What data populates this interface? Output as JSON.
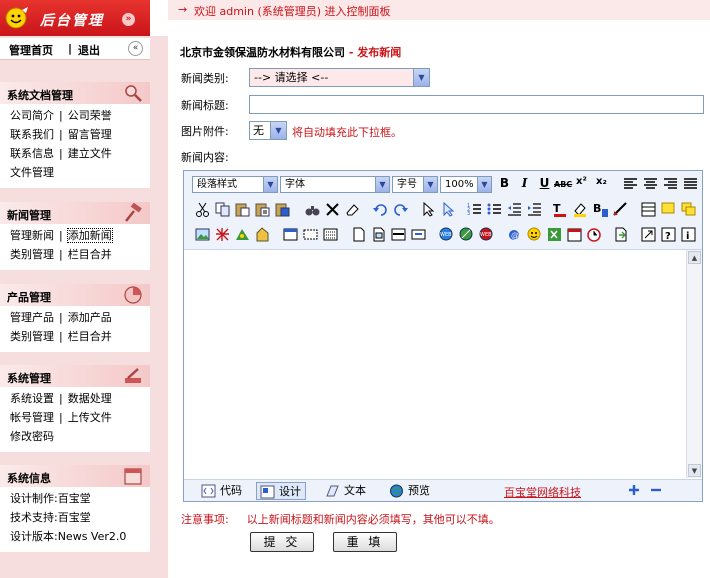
{
  "brand": {
    "title": "后台管理",
    "chevron": "»"
  },
  "nav": {
    "home": "管理首页",
    "separator": "|",
    "exit": "退出",
    "collapse": "«"
  },
  "groups": [
    {
      "title": "系统文档管理",
      "icon": "magnifier-icon",
      "rows": [
        [
          "公司简介",
          "公司荣誉"
        ],
        [
          "联系我们",
          "留言管理"
        ],
        [
          "联系信息",
          "建立文件"
        ],
        [
          "文件管理"
        ]
      ]
    },
    {
      "title": "新闻管理",
      "icon": "hammer-icon",
      "rows": [
        [
          "管理新闻",
          "添加新闻"
        ],
        [
          "类别管理",
          "栏目合并"
        ]
      ]
    },
    {
      "title": "产品管理",
      "icon": "chart-icon",
      "rows": [
        [
          "管理产品",
          "添加产品"
        ],
        [
          "类别管理",
          "栏目合并"
        ]
      ]
    },
    {
      "title": "系统管理",
      "icon": "tools-icon",
      "rows": [
        [
          "系统设置",
          "数据处理"
        ],
        [
          "帐号管理",
          "上传文件"
        ],
        [
          "修改密码"
        ]
      ]
    },
    {
      "title": "系统信息",
      "icon": "calendar-icon",
      "rows": [
        [
          "设计制作:百宝堂"
        ],
        [
          "技术支持:百宝堂"
        ],
        [
          "设计版本:News Ver2.0"
        ]
      ]
    }
  ],
  "topbar": {
    "arrow": "→",
    "text": "欢迎 admin (系统管理员) 进入控制面板"
  },
  "heading": {
    "company": "北京市金领保温防水材料有限公司",
    "dash": " - ",
    "action": "发布新闻"
  },
  "form": {
    "category_label": "新闻类别:",
    "category_value": "--> 请选择 <--",
    "title_label": "新闻标题:",
    "title_value": "",
    "image_label": "图片附件:",
    "image_value": "无",
    "image_hint": "将自动填充此下拉框。",
    "content_label": "新闻内容:"
  },
  "toolbar": {
    "paragraph_style": "段落样式",
    "font": "字体",
    "font_size": "字号",
    "zoom": "100%"
  },
  "editor_modes": [
    "代码",
    "设计",
    "文本",
    "预览"
  ],
  "editor_link": "百宝堂网络科技",
  "notice": {
    "label": "注意事项:",
    "body": "以上新闻标题和新闻内容必须填写，其他可以不填。"
  },
  "buttons": {
    "submit": "提 交",
    "reset": "重 填"
  },
  "colors": {
    "accent": "#c9141a",
    "sidebar_bg": "#f6dede",
    "toolbar_bg": "#eef3fb"
  }
}
